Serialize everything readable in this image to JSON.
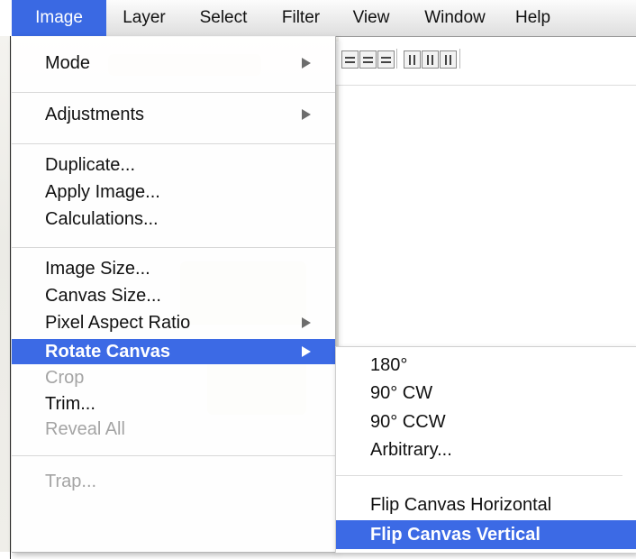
{
  "menubar": {
    "items": [
      {
        "label": "Image",
        "active": true
      },
      {
        "label": "Layer",
        "active": false
      },
      {
        "label": "Select",
        "active": false
      },
      {
        "label": "Filter",
        "active": false
      },
      {
        "label": "View",
        "active": false
      },
      {
        "label": "Window",
        "active": false
      },
      {
        "label": "Help",
        "active": false
      }
    ]
  },
  "image_menu": {
    "items": [
      {
        "label": "Mode",
        "submenu": true,
        "disabled": false
      },
      {
        "label": "Adjustments",
        "submenu": true,
        "disabled": false
      },
      {
        "label": "Duplicate...",
        "submenu": false,
        "disabled": false
      },
      {
        "label": "Apply Image...",
        "submenu": false,
        "disabled": false
      },
      {
        "label": "Calculations...",
        "submenu": false,
        "disabled": false
      },
      {
        "label": "Image Size...",
        "submenu": false,
        "disabled": false
      },
      {
        "label": "Canvas Size...",
        "submenu": false,
        "disabled": false
      },
      {
        "label": "Pixel Aspect Ratio",
        "submenu": true,
        "disabled": false
      },
      {
        "label": "Rotate Canvas",
        "submenu": true,
        "disabled": false,
        "highlighted": true
      },
      {
        "label": "Crop",
        "submenu": false,
        "disabled": true
      },
      {
        "label": "Trim...",
        "submenu": false,
        "disabled": false
      },
      {
        "label": "Reveal All",
        "submenu": false,
        "disabled": true
      },
      {
        "label": "Trap...",
        "submenu": false,
        "disabled": true
      }
    ]
  },
  "rotate_submenu": {
    "items": [
      {
        "label": "180°"
      },
      {
        "label": "90° CW"
      },
      {
        "label": "90° CCW"
      },
      {
        "label": "Arbitrary..."
      },
      {
        "label": "Flip Canvas Horizontal"
      },
      {
        "label": "Flip Canvas Vertical",
        "highlighted": true
      }
    ]
  },
  "colors": {
    "highlight": "#3c6ae5",
    "disabled_text": "#a4a4a4"
  },
  "icons": [
    "submenu-arrow-icon",
    "align-top-icon",
    "align-vcenter-icon",
    "align-bottom-icon",
    "distribute-left-icon",
    "distribute-hcenter-icon",
    "distribute-right-icon"
  ]
}
